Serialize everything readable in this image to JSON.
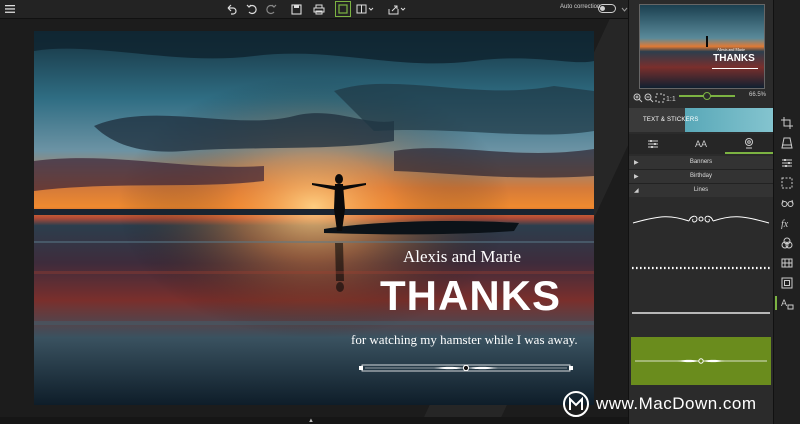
{
  "toolbar": {
    "auto_correction_label": "Auto correction",
    "auto_correction_on": false,
    "icons": [
      "menu-icon",
      "undo-icon",
      "undo-step-icon",
      "redo-icon",
      "save-icon",
      "print-icon",
      "single-view-icon",
      "compare-view-icon",
      "share-icon"
    ],
    "accent": "#7cb342"
  },
  "canvas": {
    "names_text": "Alexis and Marie",
    "thanks_text": "THANKS",
    "subtitle_text": "for watching my hamster while I was away."
  },
  "panel": {
    "zoom_value": "66.5%",
    "category_label": "TEXT & STICKERS",
    "tabs": [
      "adjustments-tab",
      "text-tab",
      "stickers-tab"
    ],
    "tab_text_glyph": "AA",
    "categories": [
      {
        "label": "Banners",
        "expanded": false
      },
      {
        "label": "Birthday",
        "expanded": false
      },
      {
        "label": "Lines",
        "expanded": true
      }
    ],
    "selected_line_index": 3,
    "selected_color": "#6a8c1d"
  },
  "watermark": {
    "text": "www.MacDown.com"
  }
}
